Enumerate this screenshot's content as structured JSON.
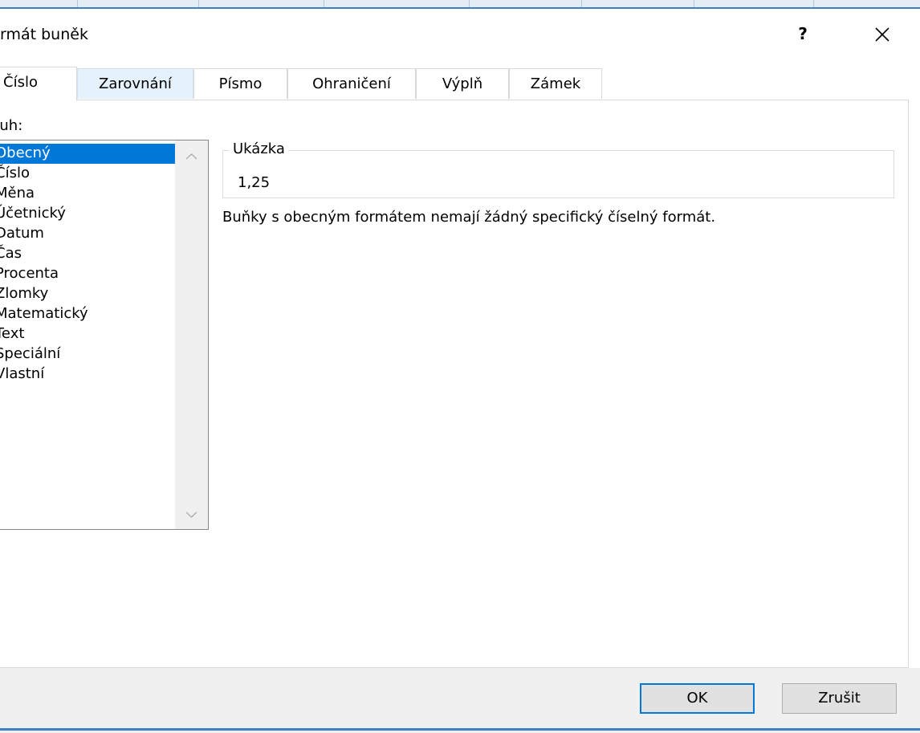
{
  "window": {
    "title": "rmát buněk",
    "help_label": "?"
  },
  "tabs": [
    {
      "label": "Číslo",
      "state": "active"
    },
    {
      "label": "Zarovnání",
      "state": "hover"
    },
    {
      "label": "Písmo",
      "state": "normal"
    },
    {
      "label": "Ohraničení",
      "state": "normal"
    },
    {
      "label": "Výplň",
      "state": "normal"
    },
    {
      "label": "Zámek",
      "state": "normal"
    }
  ],
  "category": {
    "label": "ruh:",
    "items": [
      {
        "label": "Obecný",
        "selected": true
      },
      {
        "label": "Číslo",
        "selected": false
      },
      {
        "label": "Měna",
        "selected": false
      },
      {
        "label": "Účetnický",
        "selected": false
      },
      {
        "label": "Datum",
        "selected": false
      },
      {
        "label": "Čas",
        "selected": false
      },
      {
        "label": "Procenta",
        "selected": false
      },
      {
        "label": "Zlomky",
        "selected": false
      },
      {
        "label": "Matematický",
        "selected": false
      },
      {
        "label": "Text",
        "selected": false
      },
      {
        "label": "Speciální",
        "selected": false
      },
      {
        "label": "Vlastní",
        "selected": false
      }
    ]
  },
  "sample": {
    "legend": "Ukázka",
    "value": "1,25"
  },
  "description": "Buňky s obecným formátem nemají žádný specifický číselný formát.",
  "buttons": {
    "ok_label": "OK",
    "cancel_label": "Zrušit"
  },
  "colors": {
    "selection": "#0078d7",
    "hover_tab": "#e5f1fb",
    "window_accent": "#3e7fc4"
  }
}
